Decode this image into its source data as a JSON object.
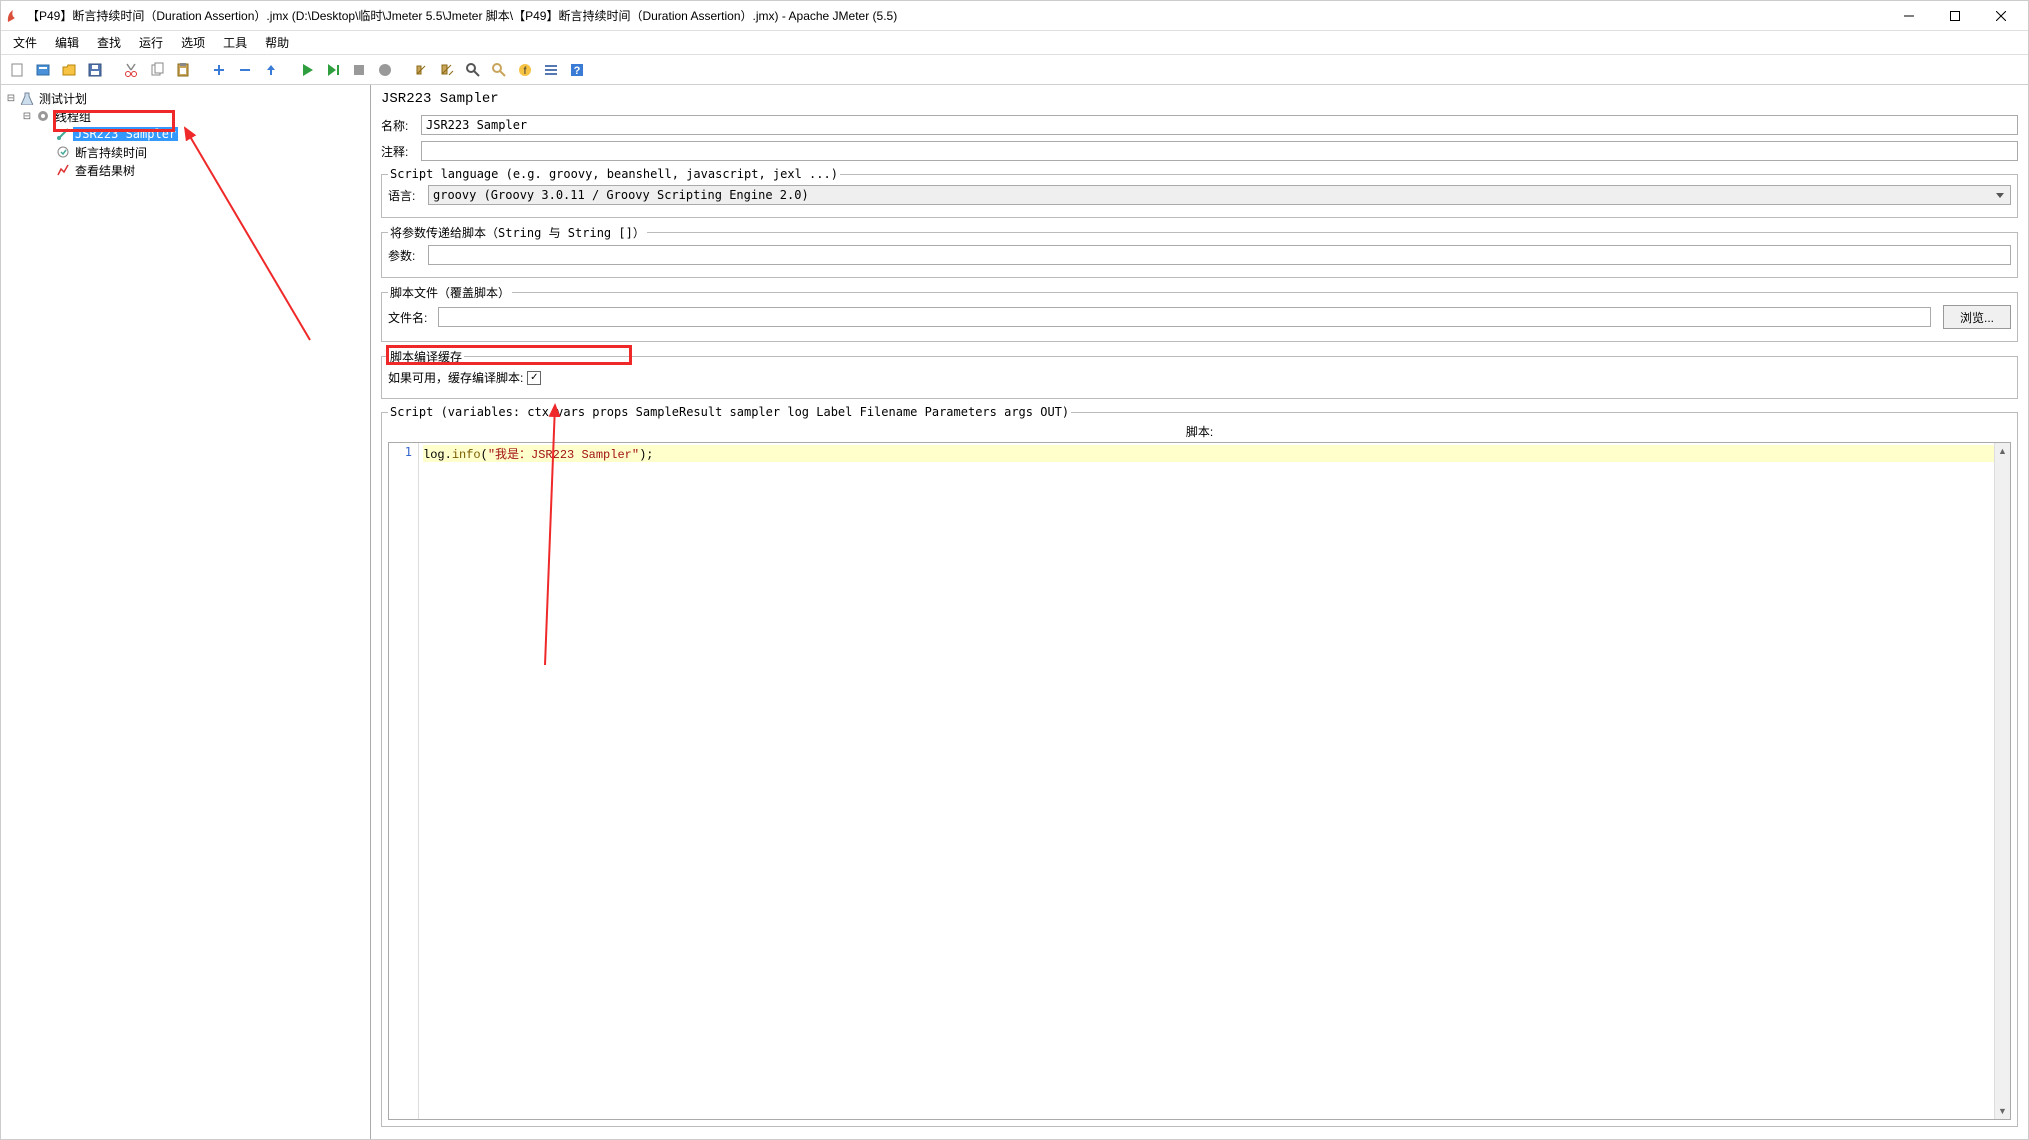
{
  "window": {
    "title": "【P49】断言持续时间（Duration Assertion）.jmx (D:\\Desktop\\临时\\Jmeter 5.5\\Jmeter 脚本\\【P49】断言持续时间（Duration Assertion）.jmx) - Apache JMeter (5.5)"
  },
  "menu": {
    "file": "文件",
    "edit": "编辑",
    "search": "查找",
    "run": "运行",
    "options": "选项",
    "tools": "工具",
    "help": "帮助"
  },
  "tree": {
    "root": "测试计划",
    "thread_group": "线程组",
    "sampler": "JSR223 Sampler",
    "assertion": "断言持续时间",
    "listener": "查看结果树"
  },
  "panel": {
    "title": "JSR223 Sampler",
    "name_label": "名称:",
    "name_value": "JSR223 Sampler",
    "comment_label": "注释:",
    "comment_value": "",
    "lang_legend": "Script language (e.g. groovy, beanshell, javascript, jexl ...)",
    "lang_label": "语言:",
    "lang_value": "groovy    (Groovy 3.0.11 / Groovy Scripting Engine 2.0)",
    "param_legend": "将参数传递给脚本（String 与 String []）",
    "param_label": "参数:",
    "param_value": "",
    "file_legend": "脚本文件（覆盖脚本）",
    "file_label": "文件名:",
    "file_value": "",
    "browse": "浏览...",
    "cache_legend": "脚本编译缓存",
    "cache_label": "如果可用，缓存编译脚本:",
    "script_legend": "Script (variables: ctx vars props SampleResult sampler log Label Filename Parameters args OUT)",
    "script_label": "脚本:",
    "line_no": "1",
    "code_obj": "log",
    "code_dot": ".",
    "code_method": "info",
    "code_open": "(",
    "code_string": "\"我是：JSR223 Sampler\"",
    "code_close": ");"
  }
}
